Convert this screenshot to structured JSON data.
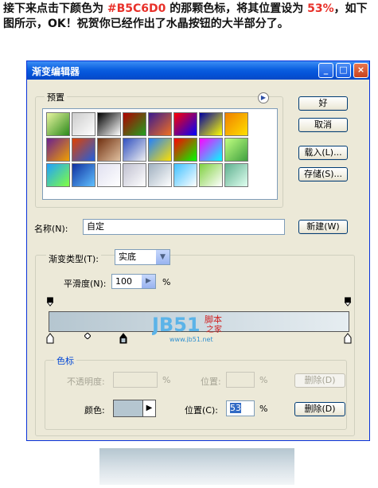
{
  "instruction": {
    "part1": "接下来点击下颜色为 ",
    "highlight_color": "#B5C6D0",
    "part2": " 的那颗色标，将其位置设为 ",
    "highlight_percent": "53%",
    "part3": "，如下图所示，OK！祝贺你已经作出了水晶按钮的大半部分了。"
  },
  "dialog": {
    "title": "渐变编辑器",
    "window_buttons": {
      "minimize": "_",
      "maximize": "□",
      "close": "×"
    },
    "presets": {
      "label": "预置",
      "swatches": [
        [
          "#e8f5a0",
          "#2b8a1a"
        ],
        [
          "#cccccc",
          "#ffffff"
        ],
        [
          "#000000",
          "#ffffff"
        ],
        [
          "#b00000",
          "#20a020"
        ],
        [
          "#3a1a90",
          "#f07020"
        ],
        [
          "#ff0000",
          "#0000ff"
        ],
        [
          "#0000a0",
          "#ffff00"
        ],
        [
          "#f08000",
          "#ffe000"
        ],
        [
          "#6a2090",
          "#f0a000"
        ],
        [
          "#e04000",
          "#2060e0"
        ],
        [
          "#703010",
          "#e0c0a0"
        ],
        [
          "#3050c0",
          "#f0f0f0"
        ],
        [
          "#2080ff",
          "#ffe000"
        ],
        [
          "#ff0000",
          "#00ff00"
        ],
        [
          "#ff00ff",
          "#00ffff"
        ],
        [
          "#c0ff80",
          "#40a040"
        ],
        [
          "#20a0ff",
          "#80ff40"
        ],
        [
          "#1030a0",
          "#60c0ff"
        ],
        [
          "#e0e0f0",
          "#ffffff"
        ],
        [
          "#c0c0d0",
          "#ffffff"
        ],
        [
          "#a0b0c0",
          "#ffffff"
        ],
        [
          "#40c0ff",
          "#ffffff"
        ],
        [
          "#80d040",
          "#ffffff"
        ],
        [
          "#60b090",
          "#e0fff0"
        ]
      ]
    },
    "buttons": {
      "ok": "好",
      "cancel": "取消",
      "load": "载入(L)...",
      "save": "存储(S)...",
      "new": "新建(W)"
    },
    "name": {
      "label": "名称(N):",
      "value": "自定"
    },
    "gradient_type": {
      "label": "渐变类型(T):",
      "value": "实底"
    },
    "smoothness": {
      "label": "平滑度(N):",
      "value": "100",
      "unit": "%"
    },
    "watermark": {
      "text1": "JB51",
      "text2": "脚本",
      "text3": "之家",
      "url": "www.jb51.net"
    },
    "stops_group": {
      "label": "色标",
      "opacity_label": "不透明度:",
      "opacity_unit": "%",
      "position_label_top": "位置:",
      "delete_top": "删除(D)",
      "color_label": "颜色:",
      "position_label": "位置(C):",
      "position_value": "53",
      "position_unit": "%",
      "delete_bottom": "删除(D)",
      "color_value": "#B5C6D0"
    }
  }
}
